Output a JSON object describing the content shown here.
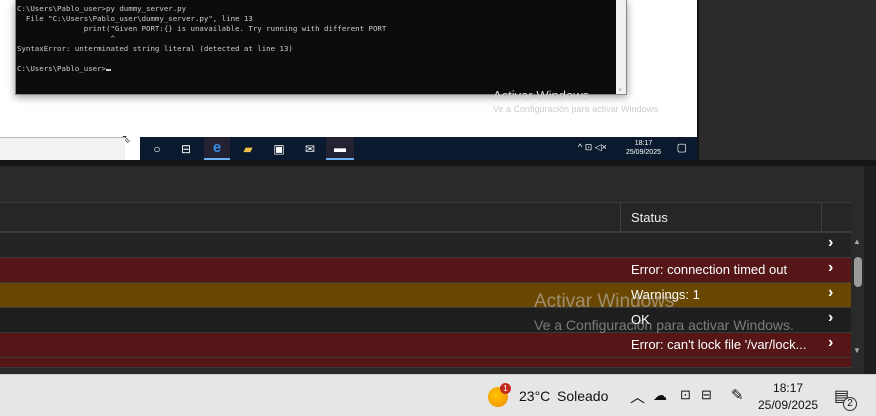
{
  "terminal": {
    "lines": [
      "C:\\Users\\Pablo_user>py dummy_server.py",
      "  File \"C:\\Users\\Pablo_user\\dummy_server.py\", line 13",
      "               print(\"Given PORT:{} is unavailable. Try running with different PORT",
      "                     ^",
      "SyntaxError: unterminated string literal (detected at line 13)",
      "",
      "C:\\Users\\Pablo_user>"
    ]
  },
  "watermark": {
    "title": "Activar Windows",
    "subtitle": "Ve a Configuración para activar Windows."
  },
  "remote_taskbar": {
    "time": "18:17",
    "date": "25/09/2025"
  },
  "table": {
    "header_status": "Status",
    "rows": [
      {
        "status": "",
        "color": "#232323"
      },
      {
        "status": "Error: connection timed out",
        "color": "#561618"
      },
      {
        "status": "Warnings: 1",
        "color": "#6a4700"
      },
      {
        "status": "OK",
        "color": "#1e1e1e"
      },
      {
        "status": "Error: can't lock file '/var/lock...",
        "color": "#561618"
      },
      {
        "status": "",
        "color": "#561618"
      }
    ]
  },
  "taskbar": {
    "weather_badge": "1",
    "temperature": "23°C",
    "weather": "Soleado",
    "time": "18:17",
    "date": "25/09/2025",
    "notifications": "2"
  }
}
